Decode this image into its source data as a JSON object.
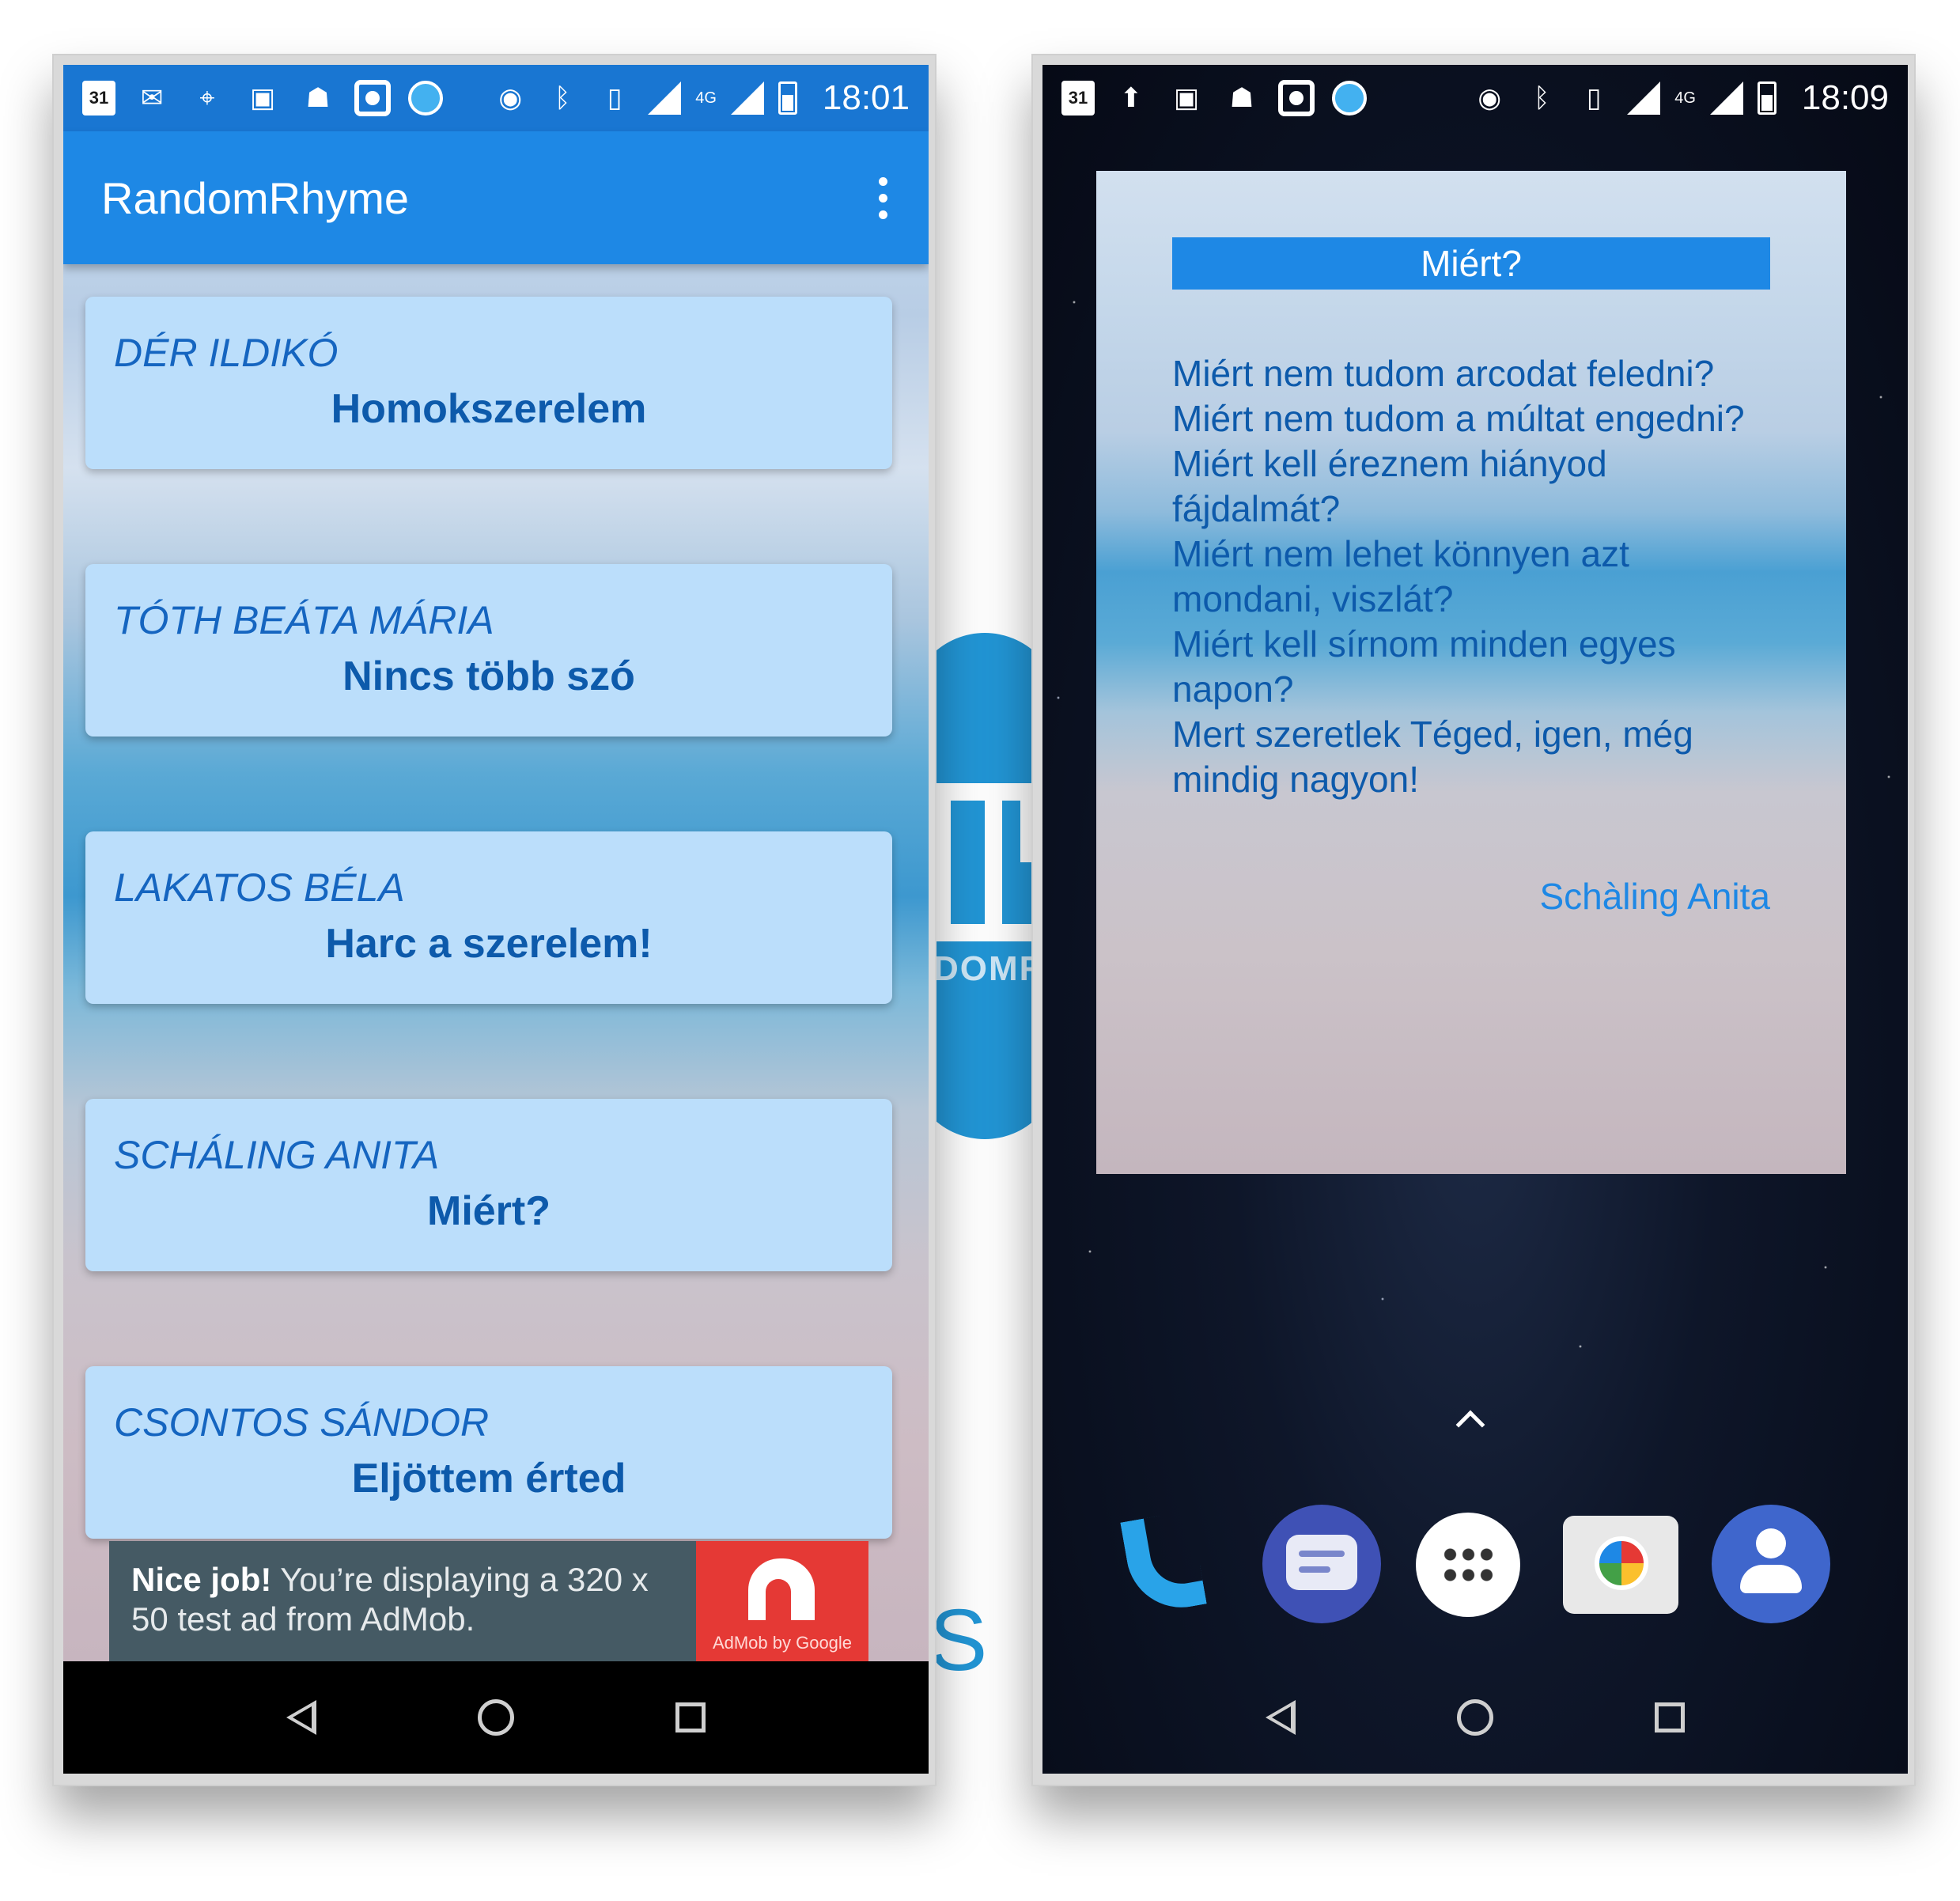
{
  "left_phone": {
    "status_bar": {
      "time": "18:01",
      "calendar_day": "31",
      "network_type": "4G",
      "icons_left": [
        "calendar-icon",
        "gmail-icon",
        "maps-icon",
        "image-icon",
        "ghost-icon",
        "record-icon",
        "app-icon"
      ],
      "icons_right": [
        "hotspot-icon",
        "bluetooth-icon",
        "vibrate-icon",
        "no-signal-icon",
        "signal-icon",
        "battery-icon"
      ]
    },
    "app_bar": {
      "title": "RandomRhyme",
      "menu_icon": "overflow-menu-icon"
    },
    "cards": [
      {
        "author": "DÉR ILDIKÓ",
        "title": "Homokszerelem"
      },
      {
        "author": "TÓTH BEÁTA MÁRIA",
        "title": "Nincs több szó"
      },
      {
        "author": "LAKATOS BÉLA",
        "title": "Harc a szerelem!"
      },
      {
        "author": "SCHÁLING ANITA",
        "title": "Miért?"
      },
      {
        "author": "CSONTOS SÁNDOR",
        "title": "Eljöttem érted"
      }
    ],
    "ad": {
      "bold": "Nice job!",
      "text": " You’re displaying a 320 x 50 test ad from AdMob.",
      "logo_text": "AdMob by Google",
      "color": "#455a64",
      "logo_color": "#e53935"
    }
  },
  "right_phone": {
    "status_bar": {
      "time": "18:09",
      "calendar_day": "31",
      "network_type": "4G"
    },
    "widget": {
      "title": "Miért?",
      "lines": [
        "Miért nem tudom arcodat feledni?",
        "Miért nem tudom a múltat engedni?",
        "Miért kell éreznem hiányod fájdalmát?",
        "Miért nem lehet könnyen azt mondani, viszlát?",
        "Miért kell sírnom minden egyes napon?",
        "Mert szeretlek Téged, igen, még mindig nagyon!"
      ],
      "author": "Schàling Anita"
    },
    "dock": [
      "phone-icon",
      "messages-icon",
      "app-drawer-icon",
      "camera-icon",
      "contacts-icon"
    ]
  },
  "navigation": {
    "buttons": [
      "back-icon",
      "home-icon",
      "recents-icon"
    ]
  },
  "background": {
    "logo_text": "DOMR",
    "tagline": "S T",
    "brand_color": "#2296d6"
  },
  "colors": {
    "app_bar": "#1e88e5",
    "status_bar": "#1976d2",
    "card": "#bbdefb",
    "card_text": "#1565c0"
  }
}
